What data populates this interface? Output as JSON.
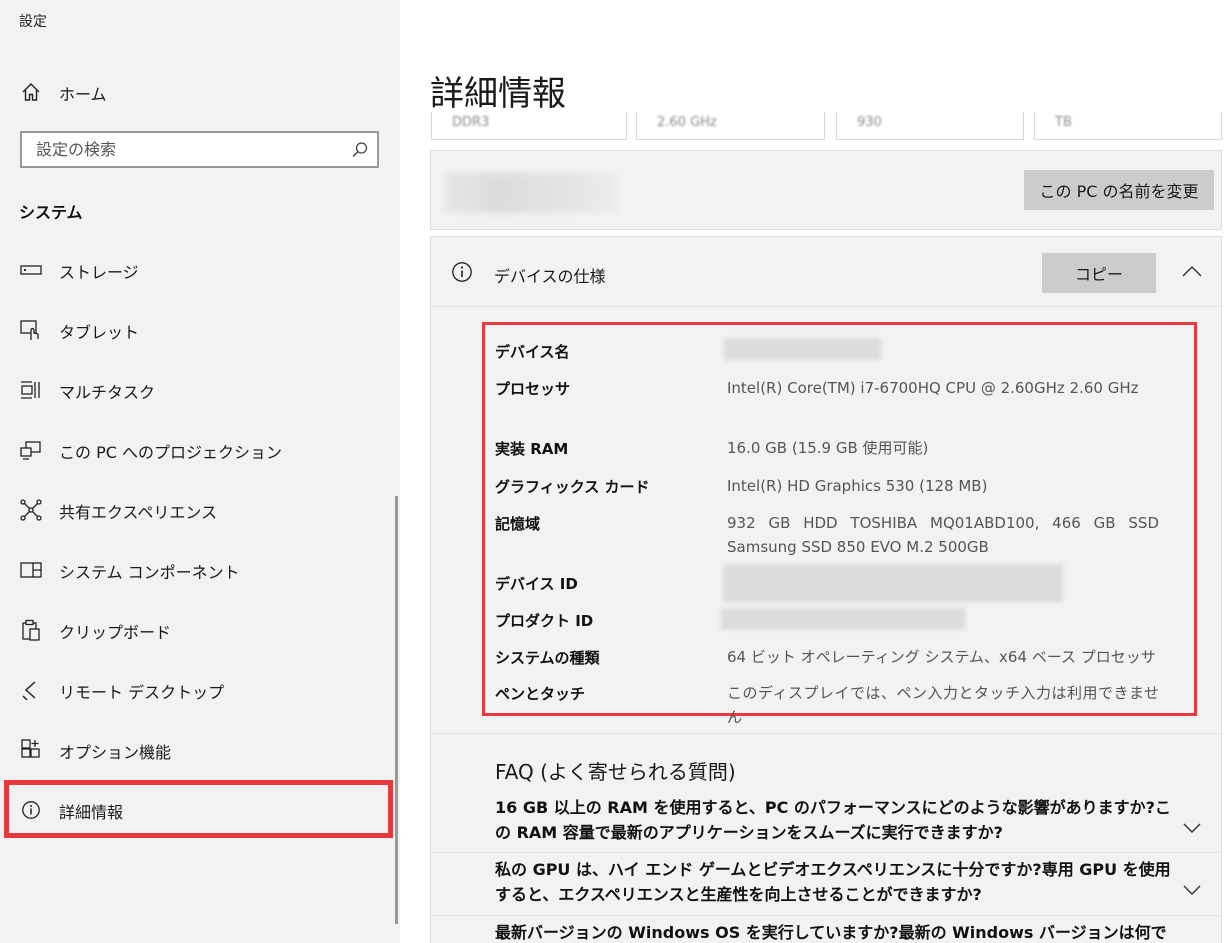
{
  "window": {
    "title": "設定"
  },
  "sidebar": {
    "home_label": "ホーム",
    "search_placeholder": "設定の検索",
    "section_title": "システム",
    "items": [
      {
        "label": "ストレージ",
        "icon": "storage-icon"
      },
      {
        "label": "タブレット",
        "icon": "tablet-icon"
      },
      {
        "label": "マルチタスク",
        "icon": "multitask-icon"
      },
      {
        "label": "この PC へのプロジェクション",
        "icon": "projection-icon"
      },
      {
        "label": "共有エクスペリエンス",
        "icon": "shared-experience-icon"
      },
      {
        "label": "システム コンポーネント",
        "icon": "system-components-icon"
      },
      {
        "label": "クリップボード",
        "icon": "clipboard-icon"
      },
      {
        "label": "リモート デスクトップ",
        "icon": "remote-desktop-icon"
      },
      {
        "label": "オプション機能",
        "icon": "optional-features-icon"
      },
      {
        "label": "詳細情報",
        "icon": "info-icon",
        "selected": true
      }
    ]
  },
  "main": {
    "page_title": "詳細情報",
    "top_cards": [
      "DDR3",
      "2.60 GHz",
      "930",
      "TB"
    ],
    "rename_button": "この PC の名前を変更",
    "spec": {
      "title": "デバイスの仕様",
      "copy_button": "コピー",
      "rows": [
        {
          "label": "デバイス名",
          "value": ""
        },
        {
          "label": "プロセッサ",
          "value": "Intel(R) Core(TM) i7-6700HQ CPU @ 2.60GHz 2.60 GHz"
        },
        {
          "label": "実装 RAM",
          "value": "16.0 GB (15.9 GB 使用可能)"
        },
        {
          "label": "グラフィックス カード",
          "value": "Intel(R) HD Graphics 530 (128 MB)"
        },
        {
          "label": "記憶域",
          "value": "932 GB HDD TOSHIBA MQ01ABD100, 466 GB SSD Samsung SSD 850 EVO M.2 500GB"
        },
        {
          "label": "デバイス ID",
          "value": ""
        },
        {
          "label": "プロダクト ID",
          "value": ""
        },
        {
          "label": "システムの種類",
          "value": "64 ビット オペレーティング システム、x64 ベース プロセッサ"
        },
        {
          "label": "ペンとタッチ",
          "value": "このディスプレイでは、ペン入力とタッチ入力は利用できません"
        }
      ]
    },
    "faq": {
      "title": "FAQ (よく寄せられる質問)",
      "items": [
        "16 GB 以上の RAM を使用すると、PC のパフォーマンスにどのような影響がありますか?この RAM 容量で最新のアプリケーションをスムーズに実行できますか?",
        "私の GPU は、ハイ エンド ゲームとビデオエクスペリエンスに十分ですか?専用 GPU を使用すると、エクスペリエンスと生産性を向上させることができますか?",
        "最新バージョンの Windows OS を実行していますか?最新の Windows バージョンは何で"
      ]
    }
  },
  "colors": {
    "highlight": "#e8393f",
    "sidebar_bg": "#f2f2f2",
    "panel_bg": "#f2f2f2",
    "button_bg": "#cccccc"
  }
}
